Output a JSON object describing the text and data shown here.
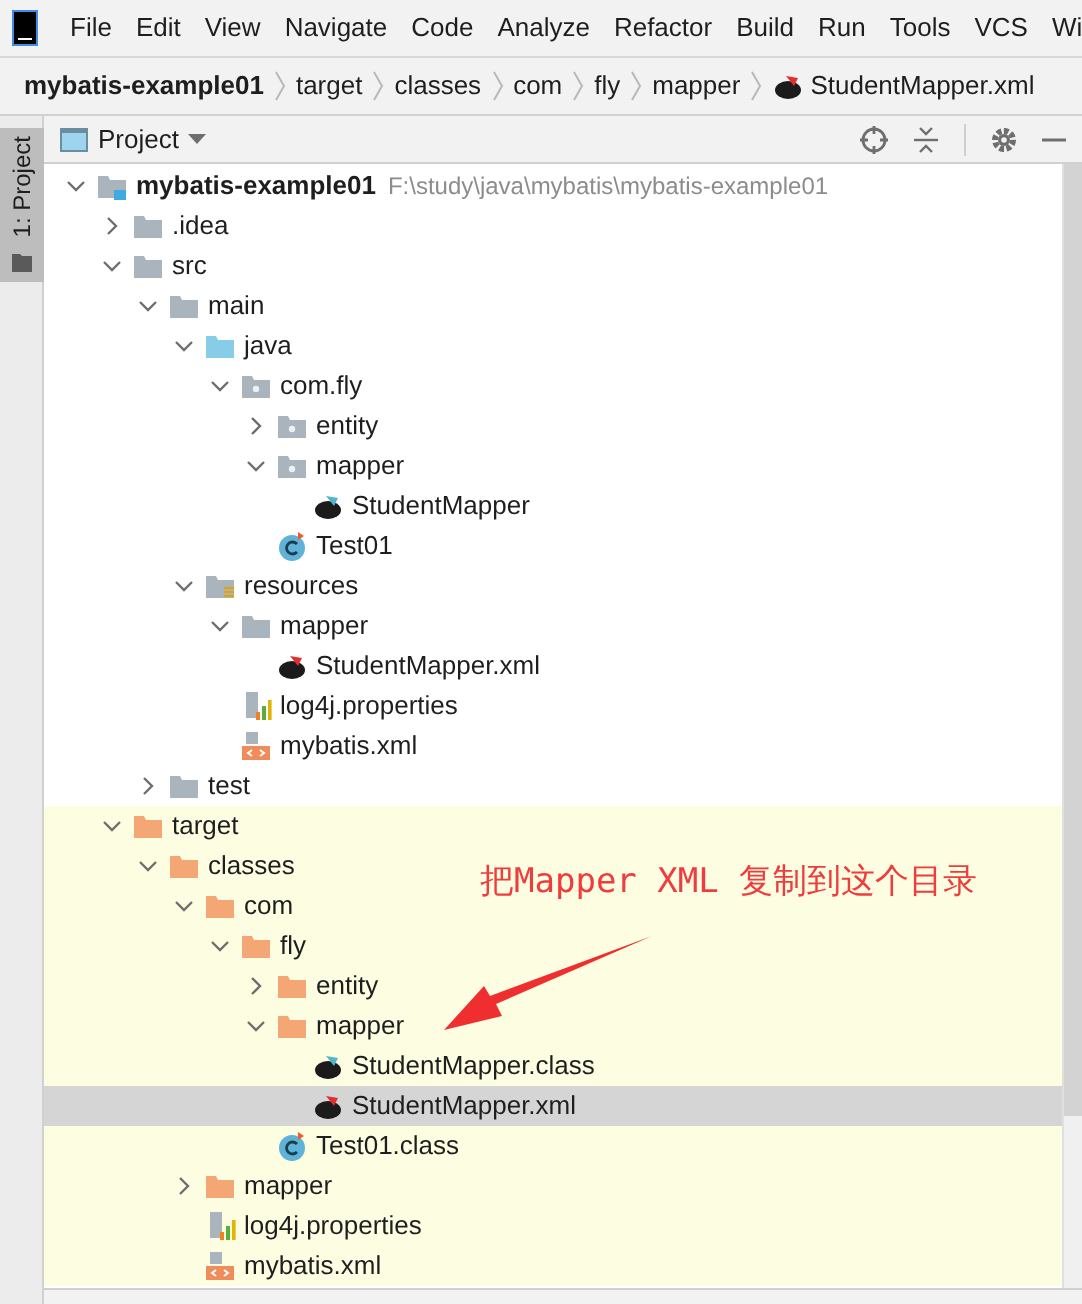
{
  "menu_bar": {
    "items": [
      "File",
      "Edit",
      "View",
      "Navigate",
      "Code",
      "Analyze",
      "Refactor",
      "Build",
      "Run",
      "Tools",
      "VCS",
      "Wi"
    ]
  },
  "breadcrumbs": [
    {
      "label": "mybatis-example01",
      "kind": "project"
    },
    {
      "label": "target",
      "kind": "folder"
    },
    {
      "label": "classes",
      "kind": "folder"
    },
    {
      "label": "com",
      "kind": "folder"
    },
    {
      "label": "fly",
      "kind": "folder"
    },
    {
      "label": "mapper",
      "kind": "folder"
    },
    {
      "label": "StudentMapper.xml",
      "kind": "mapper-xml"
    }
  ],
  "side_tab": {
    "label": "1: Project",
    "selected": true
  },
  "project_panel": {
    "title": "Project",
    "tree": [
      {
        "name": "mybatis-example01",
        "path": "F:\\study\\java\\mybatis\\mybatis-example01",
        "kind": "module",
        "expanded": true,
        "selected": false,
        "excluded": false,
        "children": [
          {
            "name": ".idea",
            "kind": "folder",
            "expanded": false,
            "selected": false,
            "excluded": false
          },
          {
            "name": "src",
            "kind": "folder",
            "expanded": true,
            "selected": false,
            "excluded": false,
            "children": [
              {
                "name": "main",
                "kind": "folder",
                "expanded": true,
                "selected": false,
                "children": [
                  {
                    "name": "java",
                    "kind": "source-folder",
                    "expanded": true,
                    "selected": false,
                    "children": [
                      {
                        "name": "com.fly",
                        "kind": "package",
                        "expanded": true,
                        "selected": false,
                        "children": [
                          {
                            "name": "entity",
                            "kind": "package",
                            "expanded": false,
                            "selected": false
                          },
                          {
                            "name": "mapper",
                            "kind": "package",
                            "expanded": true,
                            "selected": false,
                            "children": [
                              {
                                "name": "StudentMapper",
                                "kind": "mapper-interface",
                                "selected": false
                              }
                            ]
                          },
                          {
                            "name": "Test01",
                            "kind": "class",
                            "selected": false
                          }
                        ]
                      }
                    ]
                  },
                  {
                    "name": "resources",
                    "kind": "resource-folder",
                    "expanded": true,
                    "selected": false,
                    "children": [
                      {
                        "name": "mapper",
                        "kind": "folder",
                        "expanded": true,
                        "selected": false,
                        "children": [
                          {
                            "name": "StudentMapper.xml",
                            "kind": "mapper-xml",
                            "selected": false
                          }
                        ]
                      },
                      {
                        "name": "log4j.properties",
                        "kind": "properties",
                        "selected": false
                      },
                      {
                        "name": "mybatis.xml",
                        "kind": "xml",
                        "selected": false
                      }
                    ]
                  }
                ]
              },
              {
                "name": "test",
                "kind": "folder",
                "expanded": false,
                "selected": false
              }
            ]
          },
          {
            "name": "target",
            "kind": "excluded-folder",
            "expanded": true,
            "selected": false,
            "excluded": true,
            "children": [
              {
                "name": "classes",
                "kind": "excluded-folder",
                "expanded": true,
                "selected": false,
                "children": [
                  {
                    "name": "com",
                    "kind": "excluded-folder",
                    "expanded": true,
                    "selected": false,
                    "children": [
                      {
                        "name": "fly",
                        "kind": "excluded-folder",
                        "expanded": true,
                        "selected": false,
                        "children": [
                          {
                            "name": "entity",
                            "kind": "excluded-folder",
                            "expanded": false,
                            "selected": false
                          },
                          {
                            "name": "mapper",
                            "kind": "excluded-folder",
                            "expanded": true,
                            "selected": false,
                            "children": [
                              {
                                "name": "StudentMapper.class",
                                "kind": "mapper-interface",
                                "selected": false
                              },
                              {
                                "name": "StudentMapper.xml",
                                "kind": "mapper-xml",
                                "selected": true
                              }
                            ]
                          },
                          {
                            "name": "Test01.class",
                            "kind": "class",
                            "selected": false
                          }
                        ]
                      }
                    ]
                  },
                  {
                    "name": "mapper",
                    "kind": "excluded-folder",
                    "expanded": false,
                    "selected": false
                  },
                  {
                    "name": "log4j.properties",
                    "kind": "properties",
                    "selected": false
                  },
                  {
                    "name": "mybatis.xml",
                    "kind": "xml",
                    "selected": false
                  }
                ]
              }
            ]
          }
        ]
      }
    ]
  },
  "annotation": {
    "text": "把Mapper XML 复制到这个目录"
  }
}
